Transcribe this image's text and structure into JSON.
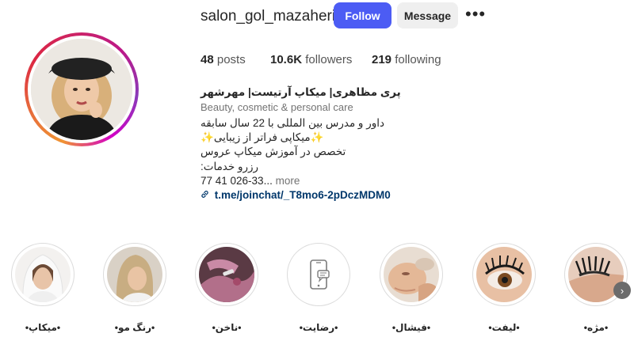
{
  "profile": {
    "username": "salon_gol_mazaheri",
    "follow_label": "Follow",
    "message_label": "Message",
    "more_label": "•••"
  },
  "stats": {
    "posts_count": "48",
    "posts_label": "posts",
    "followers_count": "10.6K",
    "followers_label": "followers",
    "following_count": "219",
    "following_label": "following"
  },
  "bio": {
    "name": "پری مظاهری| میکاپ آرتیست| مهرشهر",
    "category": "Beauty, cosmetic & personal care",
    "line1": "داور و مدرس بین المللی با 22 سال سابقه",
    "line2": "میکاپی فراتر از زیبایی",
    "sparkle": "✨",
    "line3": "تخصص در آموزش میکاپ عروس",
    "line4": "رزرو خدمات:",
    "line5": "77 41 026-33...",
    "more": "more",
    "link_icon": "🔗",
    "link": "t.me/joinchat/_T8mo6-2pDczMDM0"
  },
  "highlights": [
    {
      "label": "•میکاپ•",
      "icon": "bride-photo"
    },
    {
      "label": "•رنگ مو•",
      "icon": "hair-color-photo"
    },
    {
      "label": "•ناخن•",
      "icon": "nail-photo"
    },
    {
      "label": "•رضایت•",
      "icon": "phone-chat-icon"
    },
    {
      "label": "•فیشال•",
      "icon": "facial-photo"
    },
    {
      "label": "•لیفت•",
      "icon": "eye-lash-photo"
    },
    {
      "label": "•مژه•",
      "icon": "lash-extension-photo"
    }
  ],
  "next_arrow": "›"
}
